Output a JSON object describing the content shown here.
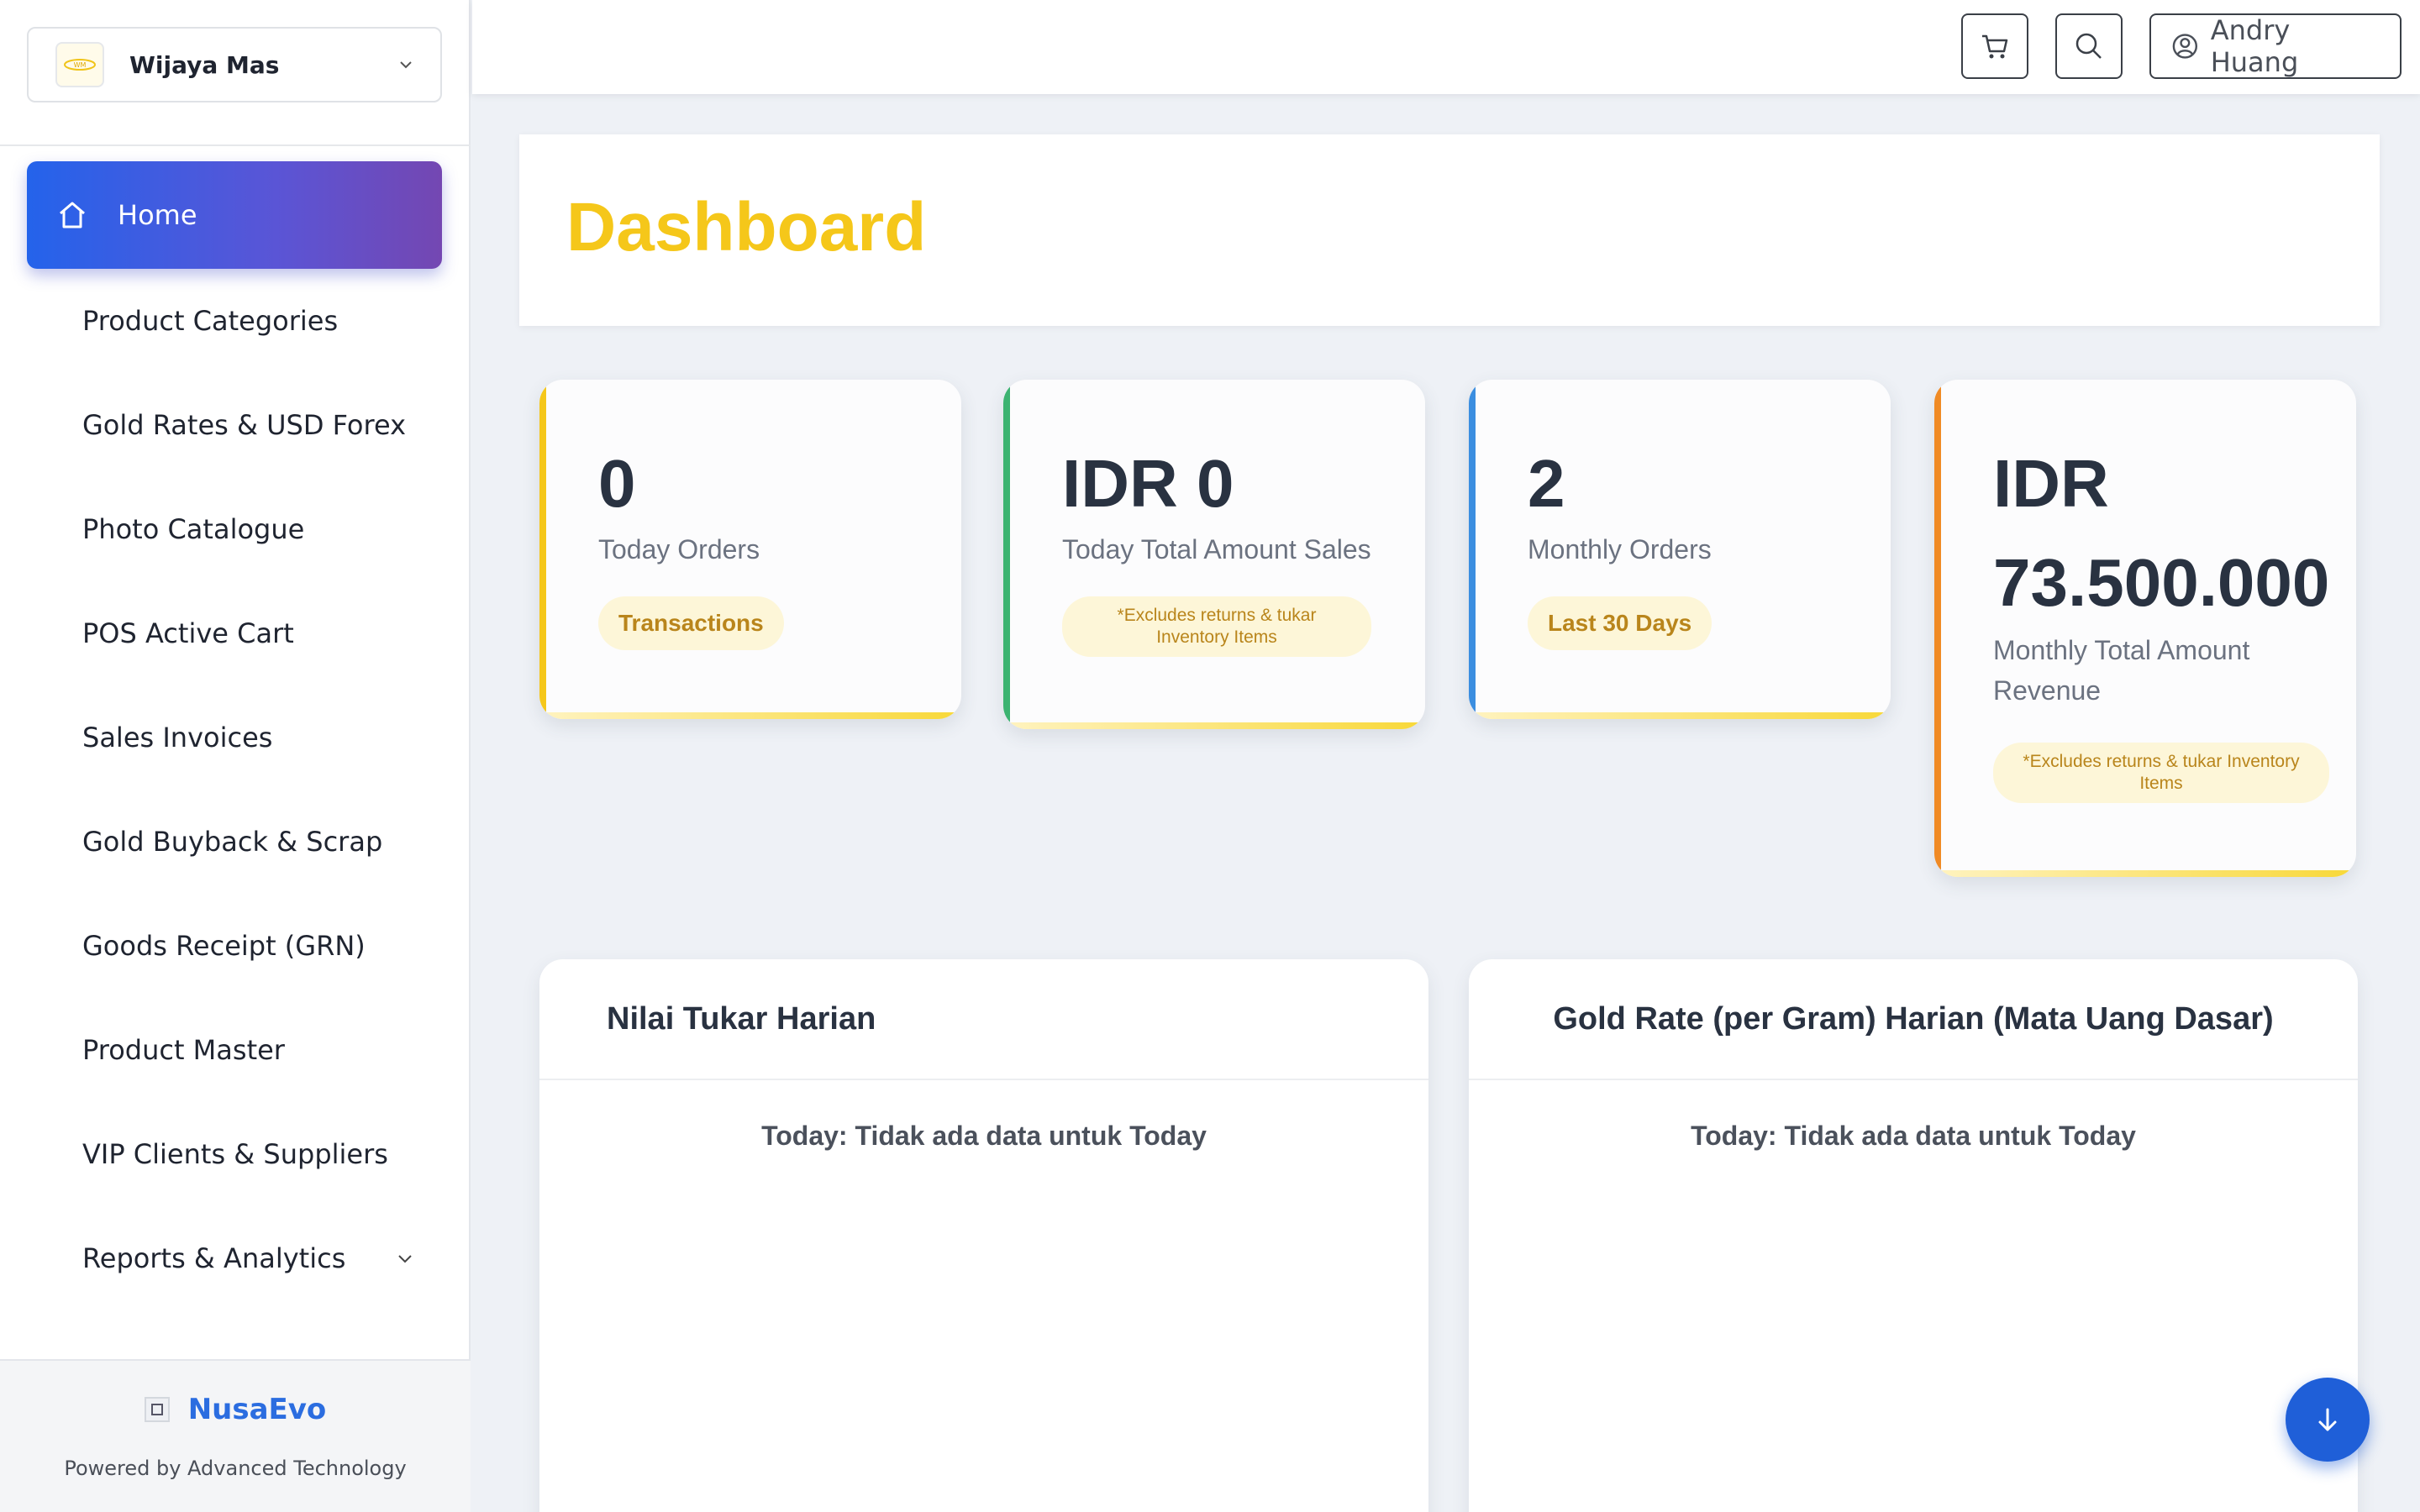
{
  "company": {
    "name": "Wijaya Mas"
  },
  "sidebar": {
    "items": [
      {
        "label": "Home",
        "active": true
      },
      {
        "label": "Product Categories"
      },
      {
        "label": "Gold Rates & USD Forex"
      },
      {
        "label": "Photo Catalogue"
      },
      {
        "label": "POS Active Cart"
      },
      {
        "label": "Sales Invoices"
      },
      {
        "label": "Gold Buyback & Scrap"
      },
      {
        "label": "Goods Receipt (GRN)"
      },
      {
        "label": "Product Master"
      },
      {
        "label": "VIP Clients & Suppliers"
      },
      {
        "label": "Reports & Analytics",
        "expandable": true
      }
    ]
  },
  "footer": {
    "brand": "NusaEvo",
    "tagline": "Powered by Advanced Technology"
  },
  "topbar": {
    "user_name": "Andry Huang"
  },
  "page": {
    "title": "Dashboard"
  },
  "stats": [
    {
      "value": "0",
      "label": "Today Orders",
      "pill": "Transactions",
      "accent": "#f5c71a"
    },
    {
      "value": "IDR 0",
      "label": "Today Total Amount Sales",
      "pill": "*Excludes returns & tukar Inventory Items",
      "accent": "#3cb371"
    },
    {
      "value": "2",
      "label": "Monthly Orders",
      "pill": "Last 30 Days",
      "accent": "#3b8ee0"
    },
    {
      "value_line1": "IDR",
      "value_line2": "73.500.000",
      "label_line1": "Monthly Total Amount",
      "label_line2": "Revenue",
      "pill": "*Excludes returns & tukar Inventory Items",
      "accent": "#f08a24"
    }
  ],
  "charts": [
    {
      "title": "Nilai Tukar Harian",
      "empty": "Today: Tidak ada data untuk Today"
    },
    {
      "title": "Gold Rate (per Gram) Harian (Mata Uang Dasar)",
      "empty": "Today: Tidak ada data untuk Today"
    }
  ],
  "colors": {
    "accent_yellow": "#f5c71a",
    "primary_blue": "#2463eb",
    "brand_blue": "#2b6de0"
  },
  "icons": {
    "cart": "cart-icon",
    "search": "search-icon",
    "user": "user-circle-icon",
    "home": "home-icon",
    "scroll": "arrow-down-icon"
  }
}
